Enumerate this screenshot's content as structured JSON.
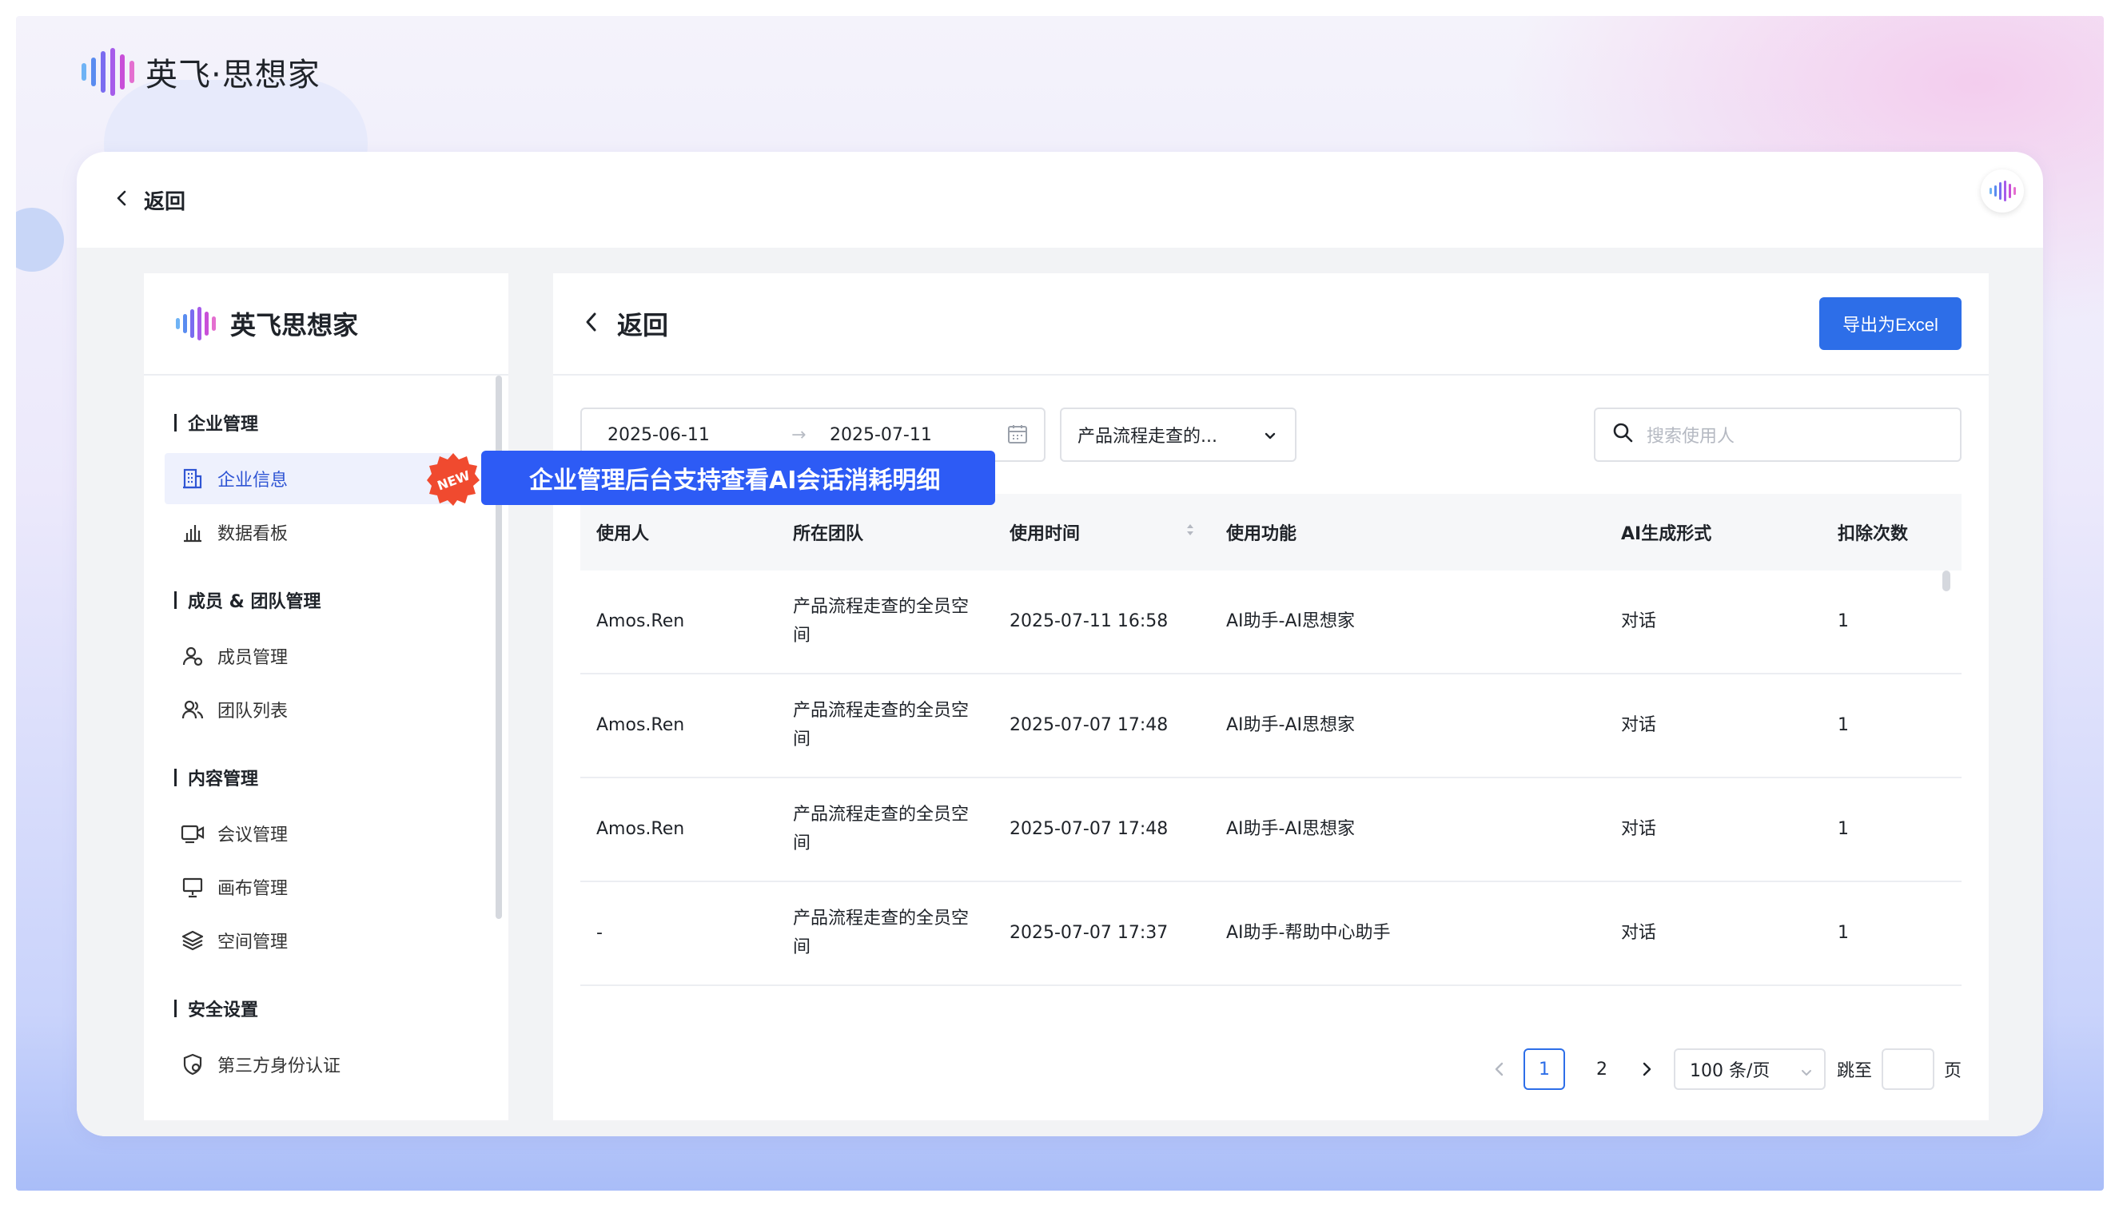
{
  "brand": {
    "name": "英飞·思想家",
    "sidebar_name": "英飞思想家"
  },
  "topbar": {
    "back_label": "返回"
  },
  "sidebar": {
    "groups": [
      {
        "label": "企业管理",
        "items": [
          {
            "label": "企业信息",
            "icon": "building-icon",
            "active": true,
            "badge": "NEW"
          },
          {
            "label": "数据看板",
            "icon": "chart-icon"
          }
        ]
      },
      {
        "label": "成员 & 团队管理",
        "items": [
          {
            "label": "成员管理",
            "icon": "member-icon"
          },
          {
            "label": "团队列表",
            "icon": "team-icon"
          }
        ]
      },
      {
        "label": "内容管理",
        "items": [
          {
            "label": "会议管理",
            "icon": "video-icon"
          },
          {
            "label": "画布管理",
            "icon": "canvas-icon"
          },
          {
            "label": "空间管理",
            "icon": "layers-icon"
          }
        ]
      },
      {
        "label": "安全设置",
        "items": [
          {
            "label": "第三方身份认证",
            "icon": "shield-icon"
          }
        ]
      }
    ]
  },
  "callout": {
    "text": "企业管理后台支持查看AI会话消耗明细"
  },
  "main": {
    "back_label": "返回",
    "export_label": "导出为Excel",
    "filters": {
      "date_start": "2025-06-11",
      "date_end": "2025-07-11",
      "date_separator": "→",
      "team_select": "产品流程走查的...",
      "search_placeholder": "搜索使用人"
    },
    "table": {
      "columns": [
        "使用人",
        "所在团队",
        "使用时间",
        "使用功能",
        "AI生成形式",
        "扣除次数"
      ],
      "rows": [
        [
          "Amos.Ren",
          "产品流程走查的全员空间",
          "2025-07-11 16:58",
          "AI助手-AI思想家",
          "对话",
          "1"
        ],
        [
          "Amos.Ren",
          "产品流程走查的全员空间",
          "2025-07-07 17:48",
          "AI助手-AI思想家",
          "对话",
          "1"
        ],
        [
          "Amos.Ren",
          "产品流程走查的全员空间",
          "2025-07-07 17:48",
          "AI助手-AI思想家",
          "对话",
          "1"
        ],
        [
          "-",
          "产品流程走查的全员空间",
          "2025-07-07 17:37",
          "AI助手-帮助中心助手",
          "对话",
          "1"
        ]
      ]
    },
    "pagination": {
      "pages": [
        "1",
        "2"
      ],
      "current": "1",
      "page_size": "100 条/页",
      "jump_label": "跳至",
      "page_unit": "页"
    }
  },
  "colors": {
    "primary": "#2d6ee8",
    "callout": "#2d5bf5",
    "badge": "#f04a2f"
  }
}
